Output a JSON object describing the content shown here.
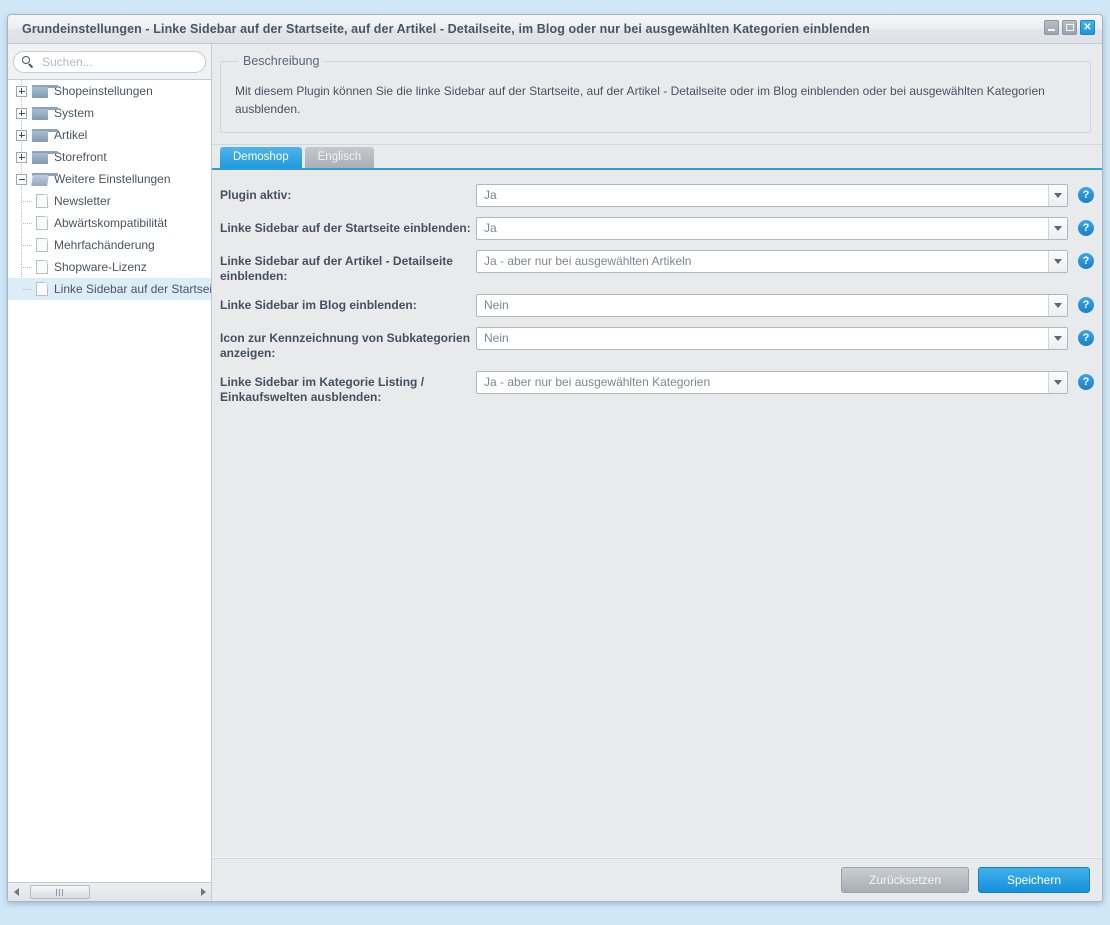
{
  "window": {
    "title": "Grundeinstellungen - Linke Sidebar auf der Startseite, auf der Artikel - Detailseite, im Blog oder nur bei ausgewählten Kategorien einblenden",
    "controls": {
      "minimize": "minimize-icon",
      "maximize": "maximize-icon",
      "close": "✕"
    }
  },
  "sidebar": {
    "search": {
      "placeholder": "Suchen...",
      "value": ""
    },
    "tree": [
      {
        "label": "Shopeinstellungen",
        "type": "folder",
        "state": "collapsed",
        "level": 0
      },
      {
        "label": "System",
        "type": "folder",
        "state": "collapsed",
        "level": 0
      },
      {
        "label": "Artikel",
        "type": "folder",
        "state": "collapsed",
        "level": 0
      },
      {
        "label": "Storefront",
        "type": "folder",
        "state": "collapsed",
        "level": 0
      },
      {
        "label": "Weitere Einstellungen",
        "type": "folder",
        "state": "expanded",
        "level": 0
      },
      {
        "label": "Newsletter",
        "type": "leaf",
        "level": 1
      },
      {
        "label": "Abwärtskompatibilität",
        "type": "leaf",
        "level": 1
      },
      {
        "label": "Mehrfachänderung",
        "type": "leaf",
        "level": 1
      },
      {
        "label": "Shopware-Lizenz",
        "type": "leaf",
        "level": 1
      },
      {
        "label": "Linke Sidebar auf der Startseite",
        "type": "leaf",
        "level": 1,
        "selected": true
      }
    ],
    "scrollbar": {
      "left_arrow": "chevron-left-icon",
      "right_arrow": "chevron-right-icon"
    }
  },
  "main": {
    "description": {
      "legend": "Beschreibung",
      "text": "Mit diesem Plugin können Sie die linke Sidebar auf der Startseite, auf der Artikel - Detailseite oder im Blog einblenden oder bei ausgewählten Kategorien ausblenden."
    },
    "tabs": [
      {
        "label": "Demoshop",
        "active": true
      },
      {
        "label": "Englisch",
        "active": false
      }
    ],
    "fields": [
      {
        "label": "Plugin aktiv:",
        "value": "Ja",
        "help": "?"
      },
      {
        "label": "Linke Sidebar auf der Startseite einblenden:",
        "value": "Ja",
        "help": "?"
      },
      {
        "label": "Linke Sidebar auf der Artikel - Detailseite einblenden:",
        "value": "Ja - aber nur bei ausgewählten Artikeln",
        "help": "?"
      },
      {
        "label": "Linke Sidebar im Blog einblenden:",
        "value": "Nein",
        "help": "?"
      },
      {
        "label": "Icon zur Kennzeichnung von Subkategorien anzeigen:",
        "value": "Nein",
        "help": "?"
      },
      {
        "label": "Linke Sidebar im Kategorie Listing / Einkaufswelten ausblenden:",
        "value": "Ja - aber nur bei ausgewählten Kategorien",
        "help": "?"
      }
    ],
    "footer": {
      "reset_label": "Zurücksetzen",
      "save_label": "Speichern"
    }
  },
  "colors": {
    "accent": "#1e9ade",
    "page_background": "#cfe7f7",
    "panel_background": "#e8eaec",
    "selected_row": "#ddedf8"
  }
}
